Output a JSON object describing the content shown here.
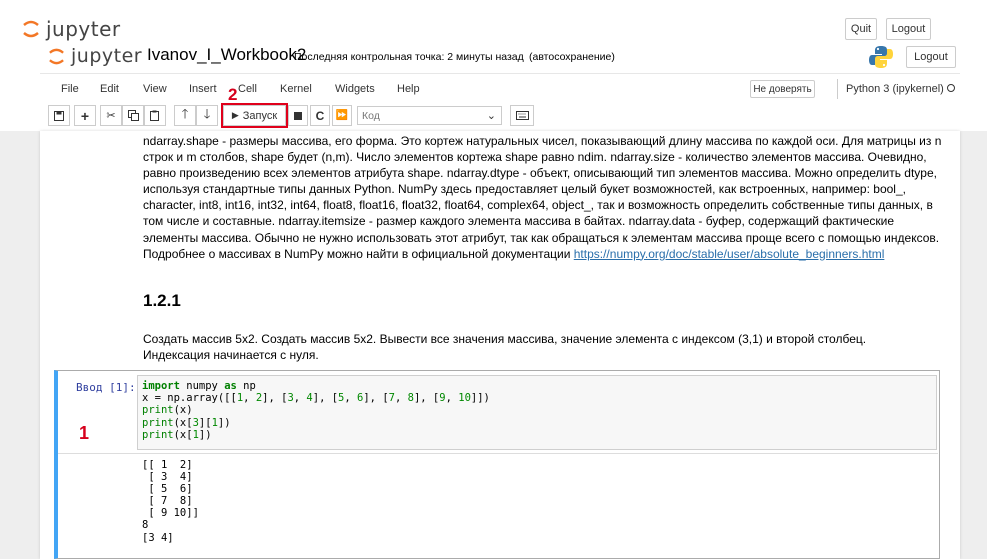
{
  "outer_header": {
    "logo_text": "jupyter",
    "quit_label": "Quit",
    "logout_label": "Logout"
  },
  "inner_header": {
    "logo_text": "jupyter",
    "notebook_title": "Ivanov_I_Workbook2",
    "checkpoint": "Последняя контрольная точка: 2 минуты назад",
    "autosave": "(автосохранение)",
    "logout_label": "Logout"
  },
  "menu": {
    "items": [
      "File",
      "Edit",
      "View",
      "Insert",
      "Cell",
      "Kernel",
      "Widgets",
      "Help"
    ],
    "trust_label": "Не доверять",
    "kernel_name": "Python 3 (ipykernel)"
  },
  "toolbar": {
    "run_label": "Запуск",
    "cell_type": "Код"
  },
  "annotations": {
    "one": "1",
    "two": "2"
  },
  "markdown": {
    "para_before": "ndarray.shape - размеры массива, его форма. Это кортеж натуральных чисел, показывающий длину массива по каждой оси. Для матрицы из n строк и m столбов, shape будет (n,m). Число элементов кортежа shape равно ndim. ndarray.size - количество элементов массива. Очевидно, равно произведению всех элементов атрибута shape. ndarray.dtype - объект, описывающий тип элементов массива. Можно определить dtype, используя стандартные типы данных Python. NumPy здесь предоставляет целый букет возможностей, как встроенных, например: bool_, character, int8, int16, int32, int64, float8, float16, float32, float64, complex64, object_, так и возможность определить собственные типы данных, в том числе и составные. ndarray.itemsize - размер каждого элемента массива в байтах. ndarray.data - буфер, содержащий фактические элементы массива. Обычно не нужно использовать этот атрибут, так как обращаться к элементам массива проще всего с помощью индексов. Подробнее о массивах в NumPy можно найти в официальной документации ",
    "link": "https://numpy.org/doc/stable/user/absolute_beginners.html",
    "heading": "1.2.1",
    "task": "Создать массив 5х2. Создать массив 5х2. Вывести все значения массива, значение элемента с индексом (3,1) и второй столбец. Индексация начинается с нуля."
  },
  "code_cell": {
    "prompt": "Ввод [1]:",
    "lines": [
      "import numpy as np",
      "x = np.array([[1, 2], [3, 4], [5, 6], [7, 8], [9, 10]])",
      "print(x)",
      "print(x[3][1])",
      "print(x[1])"
    ],
    "output": "[[ 1  2]\n [ 3  4]\n [ 5  6]\n [ 7  8]\n [ 9 10]]\n8\n[3 4]"
  }
}
